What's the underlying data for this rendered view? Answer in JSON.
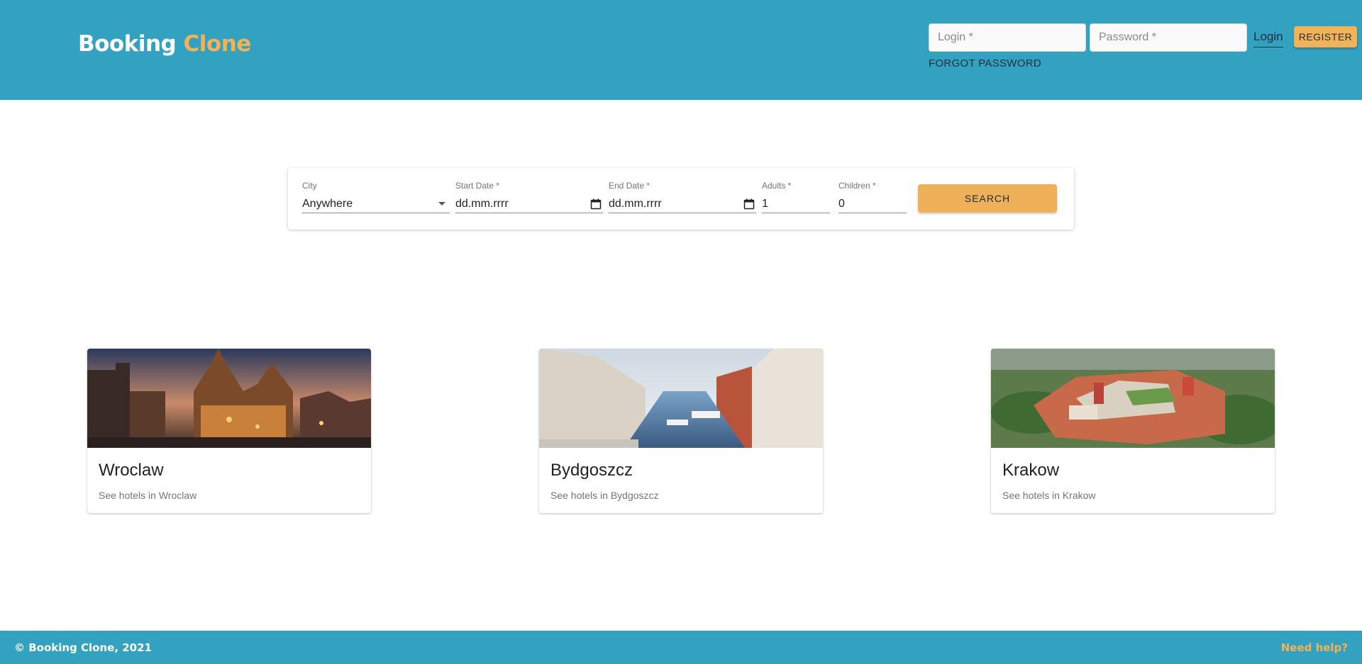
{
  "header": {
    "brand_main": "Booking",
    "brand_accent": "Clone",
    "login_placeholder": "Login *",
    "password_placeholder": "Password *",
    "login_link": "Login",
    "register_button": "REGISTER",
    "forgot_password": "FORGOT PASSWORD"
  },
  "search": {
    "city": {
      "label": "City",
      "value": "Anywhere"
    },
    "start_date": {
      "label": "Start Date *",
      "value": "dd.mm.rrrr"
    },
    "end_date": {
      "label": "End Date *",
      "value": "dd.mm.rrrr"
    },
    "adults": {
      "label": "Adults *",
      "value": "1"
    },
    "children": {
      "label": "Children *",
      "value": "0"
    },
    "button": "SEARCH"
  },
  "cities": [
    {
      "name": "Wroclaw",
      "link": "See hotels in Wroclaw"
    },
    {
      "name": "Bydgoszcz",
      "link": "See hotels in Bydgoszcz"
    },
    {
      "name": "Krakow",
      "link": "See hotels in Krakow"
    }
  ],
  "footer": {
    "copyright": "© Booking Clone, 2021",
    "help": "Need help?"
  },
  "colors": {
    "primary": "#33a2c0",
    "accent": "#f2b257"
  },
  "icons": [
    "calendar-icon",
    "chevron-down-icon"
  ]
}
